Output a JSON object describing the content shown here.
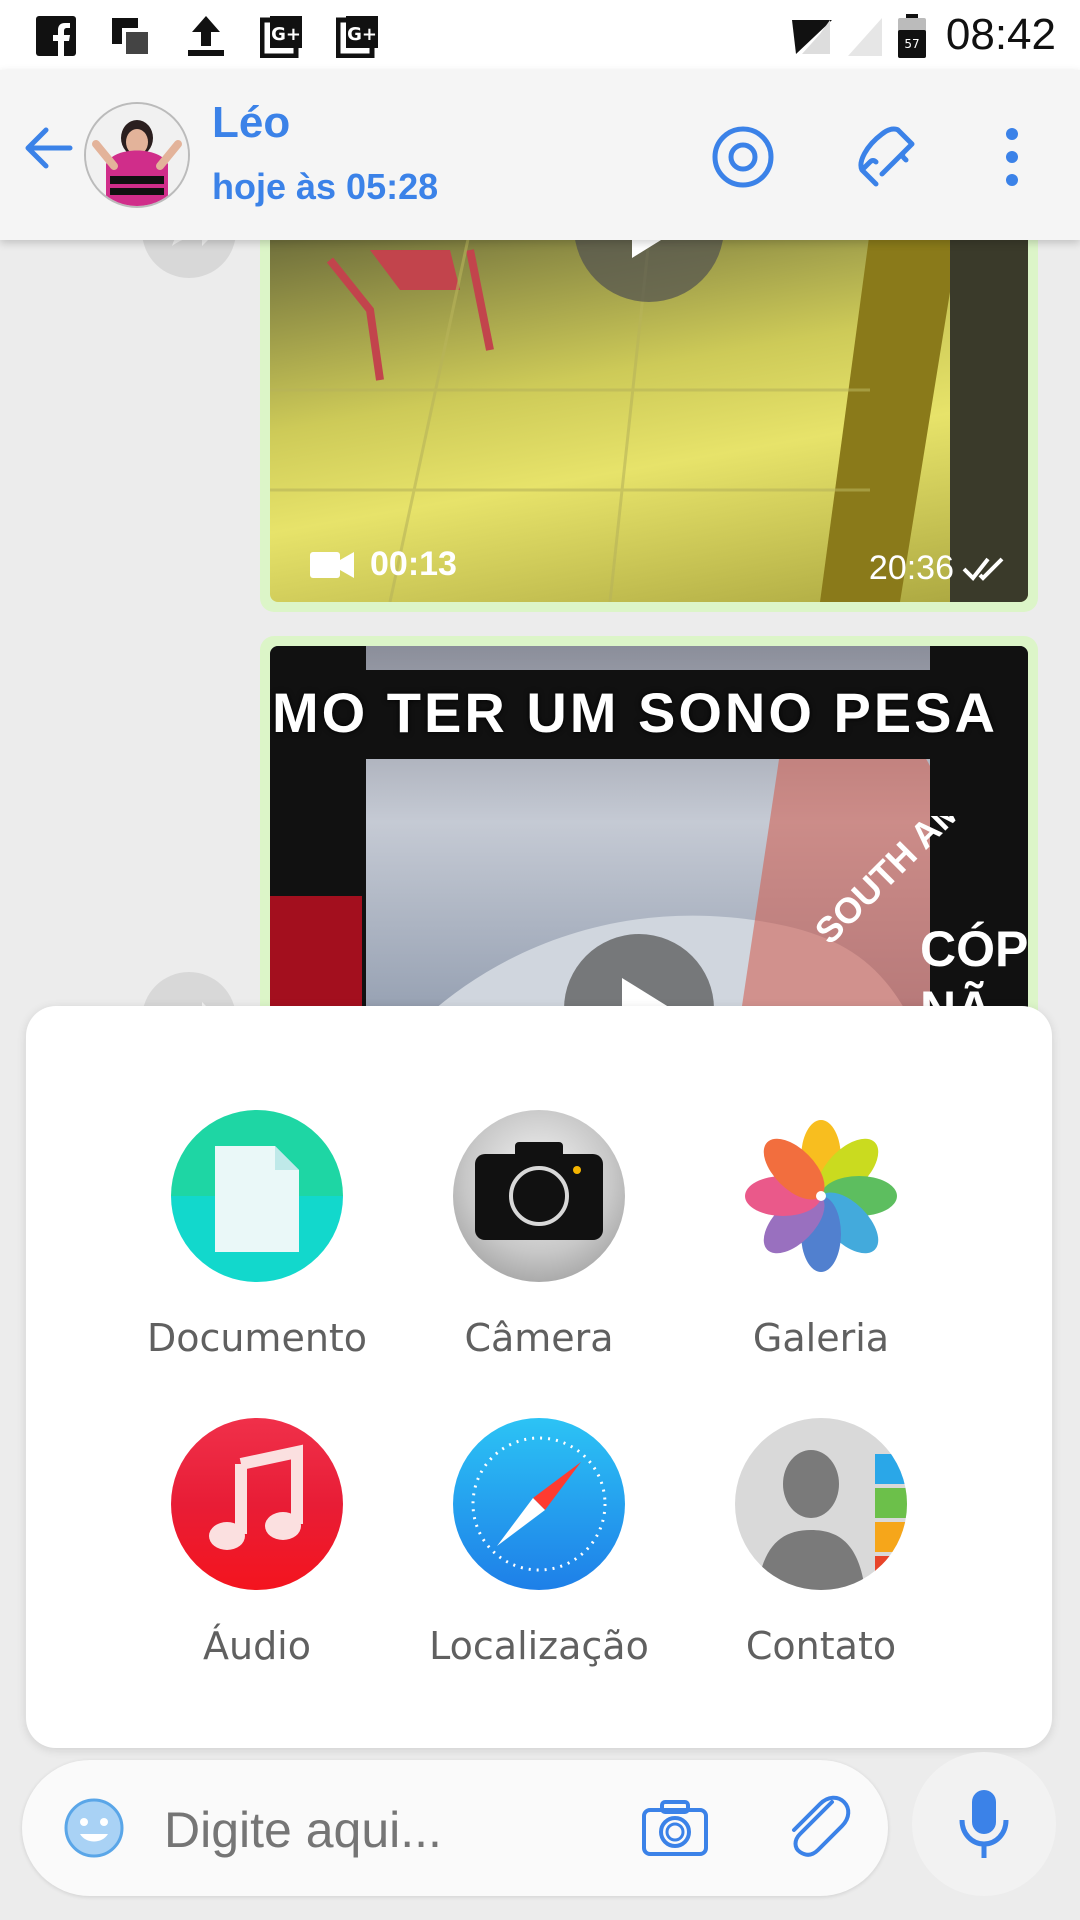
{
  "status_bar": {
    "time": "08:42",
    "battery_level": "57",
    "notification_icons": [
      "facebook-icon",
      "screenshot-icon",
      "upload-icon",
      "google-plus-icon",
      "google-plus-icon"
    ]
  },
  "header": {
    "contact_name": "Léo",
    "last_seen": "hoje às 05:28"
  },
  "messages": [
    {
      "type": "video",
      "duration": "00:13",
      "time": "20:36",
      "status": "read"
    },
    {
      "type": "video",
      "caption": "MO TER UM SONO PESA",
      "overlay_text": "SOUTH AMER\nCÓP\nNÃ"
    }
  ],
  "attachments": [
    {
      "label": "Documento",
      "icon": "document-icon"
    },
    {
      "label": "Câmera",
      "icon": "camera-icon"
    },
    {
      "label": "Galeria",
      "icon": "gallery-icon"
    },
    {
      "label": "Áudio",
      "icon": "audio-icon"
    },
    {
      "label": "Localização",
      "icon": "location-icon"
    },
    {
      "label": "Contato",
      "icon": "contact-icon"
    }
  ],
  "input": {
    "placeholder": "Digite aqui..."
  },
  "colors": {
    "accent": "#3b82e8",
    "bubble": "#dcf5c8"
  }
}
